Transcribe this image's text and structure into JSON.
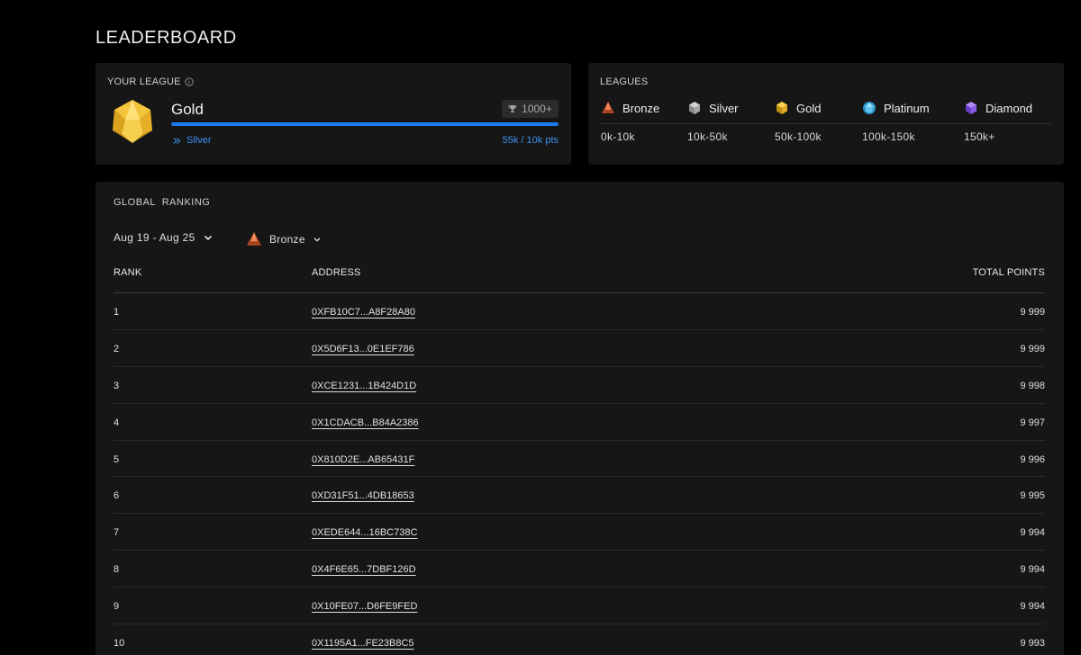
{
  "page": {
    "title": "LEADERBOARD"
  },
  "your_league": {
    "label": "YOUR LEAGUE",
    "league_name": "Gold",
    "points_chip": "1000+",
    "next_league": "Silver",
    "points_progress": "55k / 10k pts",
    "progress_fraction": 1.0,
    "badge_icon": "gold-league-icon",
    "accent": "#1b7bea"
  },
  "leagues": {
    "label": "LEAGUES",
    "items": [
      {
        "name": "Bronze",
        "range": "0k-10k",
        "icon": "bronze-league-icon"
      },
      {
        "name": "Silver",
        "range": "10k-50k",
        "icon": "silver-league-icon"
      },
      {
        "name": "Gold",
        "range": "50k-100k",
        "icon": "gold-league-icon"
      },
      {
        "name": "Platinum",
        "range": "100k-150k",
        "icon": "platinum-league-icon"
      },
      {
        "name": "Diamond",
        "range": "150k+",
        "icon": "diamond-league-icon"
      }
    ]
  },
  "ranking": {
    "label": "GLOBAL  RANKING",
    "week_filter": "Aug 19 - Aug 25",
    "league_filter": "Bronze",
    "columns": {
      "rank": "RANK",
      "address": "ADDRESS",
      "points": "TOTAL POINTS"
    },
    "rows": [
      {
        "rank": "1",
        "address": "0XFB10C7...A8F28A80",
        "points": "9 999"
      },
      {
        "rank": "2",
        "address": "0X5D6F13...0E1EF786",
        "points": "9 999"
      },
      {
        "rank": "3",
        "address": "0XCE1231...1B424D1D",
        "points": "9 998"
      },
      {
        "rank": "4",
        "address": "0X1CDACB...B84A2386",
        "points": "9 997"
      },
      {
        "rank": "5",
        "address": "0X810D2E...AB65431F",
        "points": "9 996"
      },
      {
        "rank": "6",
        "address": "0XD31F51...4DB18653",
        "points": "9 995"
      },
      {
        "rank": "7",
        "address": "0XEDE644...16BC738C",
        "points": "9 994"
      },
      {
        "rank": "8",
        "address": "0X4F6E65...7DBF126D",
        "points": "9 994"
      },
      {
        "rank": "9",
        "address": "0X10FE07...D6FE9FED",
        "points": "9 994"
      },
      {
        "rank": "10",
        "address": "0X1195A1...FE23B8C5",
        "points": "9 993"
      }
    ]
  }
}
